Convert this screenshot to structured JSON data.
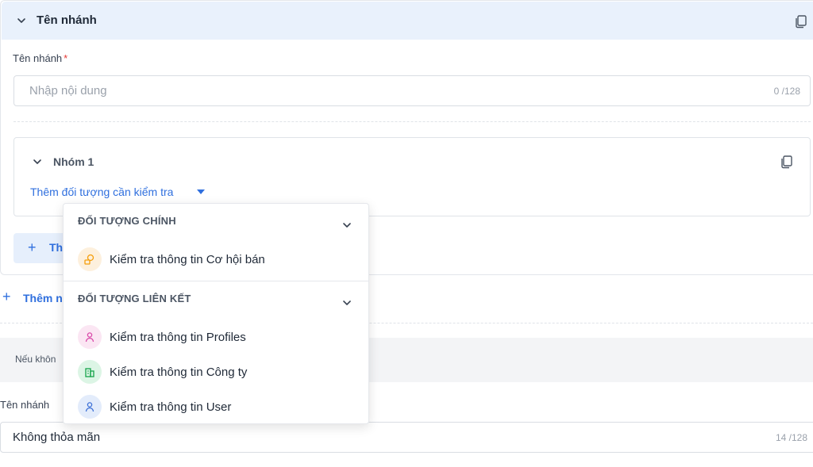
{
  "branch": {
    "header_title": "Tên nhánh",
    "name_label": "Tên nhánh",
    "required_mark": "*",
    "name_placeholder": "Nhập nội dung",
    "name_counter": "0 /128"
  },
  "group": {
    "title": "Nhóm 1",
    "add_object_label": "Thêm đối tượng cần kiểm tra"
  },
  "add_condition_label": "Th",
  "add_branch_label": "Thêm n",
  "else": {
    "note": "Nếu khôn",
    "name_label": "Tên nhánh",
    "name_value": "Không thỏa mãn",
    "name_counter": "14 /128"
  },
  "dropdown": {
    "sections": [
      {
        "title": "ĐỐI TƯỢNG CHÍNH",
        "items": [
          {
            "label": "Kiểm tra thông tin Cơ hội bán",
            "icon": "sales-opportunity-icon",
            "color": "#f59e0b",
            "bg": "#fdf0dd"
          }
        ]
      },
      {
        "title": "ĐỐI TƯỢNG LIÊN KẾT",
        "items": [
          {
            "label": "Kiểm tra thông tin Profiles",
            "icon": "profile-icon",
            "color": "#d946a8",
            "bg": "#fbe6f3"
          },
          {
            "label": "Kiểm tra thông tin Công ty",
            "icon": "company-icon",
            "color": "#16a34a",
            "bg": "#dcf5e5"
          },
          {
            "label": "Kiểm tra thông tin User",
            "icon": "user-icon",
            "color": "#3b6fd6",
            "bg": "#e3ecfb"
          }
        ]
      }
    ]
  },
  "colors": {
    "accent": "#2f6fde",
    "header_bg": "#e9f1fc",
    "required": "#e53935"
  }
}
